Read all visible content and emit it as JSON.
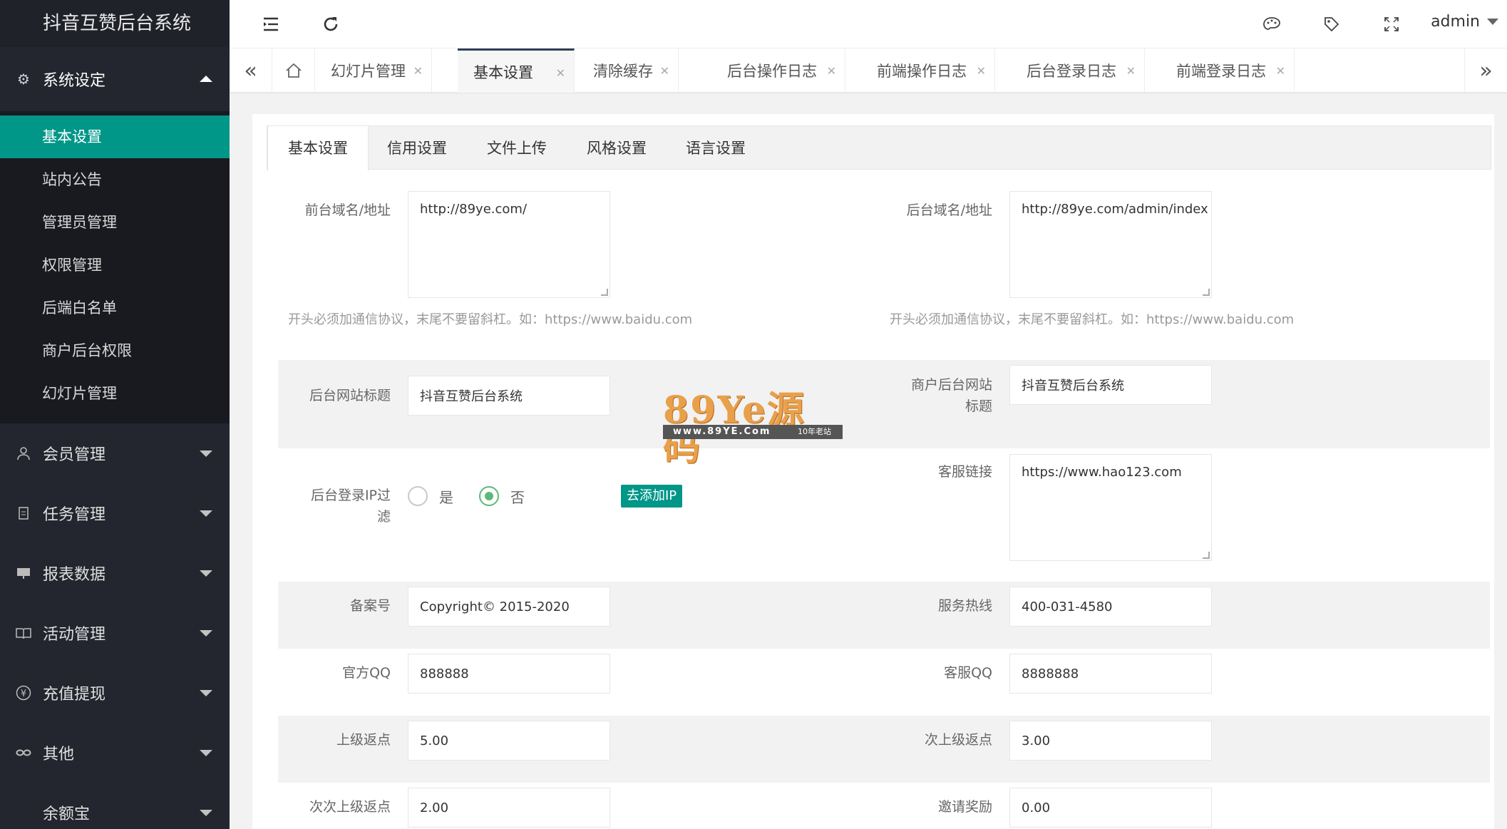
{
  "app": {
    "title": "抖音互赞后台系统"
  },
  "sidebar": {
    "section": {
      "label": "系统设定",
      "icon": "gear-icon"
    },
    "subitems": [
      {
        "label": "基本设置",
        "active": true
      },
      {
        "label": "站内公告"
      },
      {
        "label": "管理员管理"
      },
      {
        "label": "权限管理"
      },
      {
        "label": "后端白名单"
      },
      {
        "label": "商户后台权限"
      },
      {
        "label": "幻灯片管理"
      }
    ],
    "items": [
      {
        "label": "会员管理",
        "icon": "user-icon"
      },
      {
        "label": "任务管理",
        "icon": "document-icon"
      },
      {
        "label": "报表数据",
        "icon": "monitor-icon"
      },
      {
        "label": "活动管理",
        "icon": "book-icon"
      },
      {
        "label": "充值提现",
        "icon": "yen-icon"
      },
      {
        "label": "其他",
        "icon": "link-icon"
      },
      {
        "label": "余额宝",
        "icon": ""
      }
    ]
  },
  "header": {
    "user": "admin"
  },
  "tabs": [
    {
      "label": "幻灯片管理"
    },
    {
      "label": "基本设置",
      "active": true
    },
    {
      "label": "清除缓存"
    },
    {
      "label": "后台操作日志"
    },
    {
      "label": "前端操作日志"
    },
    {
      "label": "后台登录日志"
    },
    {
      "label": "前端登录日志"
    }
  ],
  "settings_tabs": [
    "基本设置",
    "信用设置",
    "文件上传",
    "风格设置",
    "语言设置"
  ],
  "form": {
    "front_domain": {
      "label": "前台域名/地址",
      "value": "http://89ye.com/"
    },
    "back_domain": {
      "label": "后台域名/地址",
      "value": "http://89ye.com/admin/index"
    },
    "hint": "开头必须加通信协议，末尾不要留斜杠。如：https://www.baidu.com",
    "site_title": {
      "label": "后台网站标题",
      "value": "抖音互赞后台系统"
    },
    "merchant_title": {
      "label_1": "商户后台网站",
      "label_2": "标题",
      "value": "抖音互赞后台系统"
    },
    "ip_filter": {
      "label_1": "后台登录IP过",
      "label_2": "滤",
      "yes": "是",
      "no": "否",
      "selected": "否",
      "add_ip": "去添加IP"
    },
    "service_link": {
      "label": "客服链接",
      "value": "https://www.hao123.com"
    },
    "icp": {
      "label": "备案号",
      "value": "Copyright© 2015-2020"
    },
    "hotline": {
      "label": "服务热线",
      "value": "400-031-4580"
    },
    "official_qq": {
      "label": "官方QQ",
      "value": "888888"
    },
    "service_qq": {
      "label": "客服QQ",
      "value": "8888888"
    },
    "rebate_1": {
      "label": "上级返点",
      "value": "5.00"
    },
    "rebate_2": {
      "label": "次上级返点",
      "value": "3.00"
    },
    "rebate_3": {
      "label": "次次上级返点",
      "value": "2.00"
    },
    "invite_reward": {
      "label": "邀请奖励",
      "value": "0.00"
    }
  },
  "watermark": {
    "main": "89Ye源码",
    "url": "www.89YE.Com",
    "tag": "10年老站"
  },
  "colors": {
    "accent": "#009688",
    "sidebar_bg": "#23262e",
    "radio_on": "#5fb878"
  }
}
